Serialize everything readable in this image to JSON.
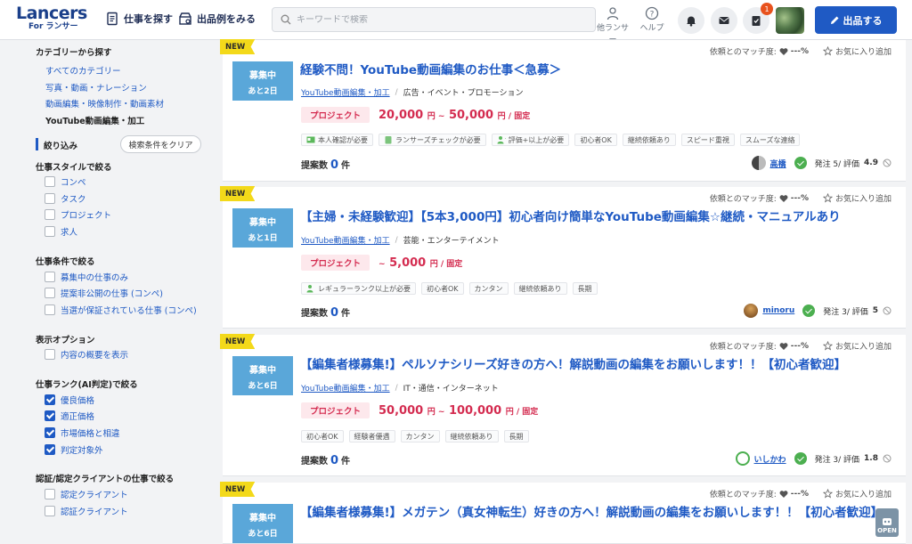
{
  "header": {
    "logo_main": "Lancers",
    "logo_sub": "For ランサー",
    "nav_find_jobs": "仕事を探す",
    "nav_examples": "出品例をみる",
    "search_placeholder": "キーワードで検索",
    "other_lancers": "他ランサー",
    "help": "ヘルプ",
    "notification_count": "1",
    "post_button": "出品する"
  },
  "sidebar": {
    "category_heading": "カテゴリーから探す",
    "categories": [
      "すべてのカテゴリー",
      "写真・動画・ナレーション",
      "動画編集・映像制作・動画素材"
    ],
    "current_category": "YouTube動画編集・加工",
    "filter_heading": "絞り込み",
    "clear_button": "検索条件をクリア",
    "groups": [
      {
        "title": "仕事スタイルで絞る",
        "items": [
          {
            "label": "コンペ",
            "checked": false
          },
          {
            "label": "タスク",
            "checked": false
          },
          {
            "label": "プロジェクト",
            "checked": false
          },
          {
            "label": "求人",
            "checked": false
          }
        ]
      },
      {
        "title": "仕事条件で絞る",
        "items": [
          {
            "label": "募集中の仕事のみ",
            "checked": false
          },
          {
            "label": "提案非公開の仕事 (コンペ)",
            "checked": false
          },
          {
            "label": "当選が保証されている仕事 (コンペ)",
            "checked": false
          }
        ]
      },
      {
        "title": "表示オプション",
        "items": [
          {
            "label": "内容の概要を表示",
            "checked": false
          }
        ]
      },
      {
        "title": "仕事ランク(AI判定)で絞る",
        "items": [
          {
            "label": "優良価格",
            "checked": true
          },
          {
            "label": "適正価格",
            "checked": true
          },
          {
            "label": "市場価格と相違",
            "checked": true
          },
          {
            "label": "判定対象外",
            "checked": true
          }
        ]
      },
      {
        "title": "認証/認定クライアントの仕事で絞る",
        "items": [
          {
            "label": "認定クライアント",
            "checked": false
          },
          {
            "label": "認証クライアント",
            "checked": false
          }
        ]
      }
    ]
  },
  "common": {
    "new_label": "NEW",
    "match_label": "依頼とのマッチ度:",
    "match_value": "---%",
    "fav_label": "お気に入り追加",
    "project_label": "プロジェクト",
    "proposals_label": "提案数",
    "proposals_unit": "件",
    "open_label": "OPEN"
  },
  "jobs": [
    {
      "status": "募集中",
      "remaining": "あと2日",
      "title": "経験不問！YouTube動画編集のお仕事＜急募＞",
      "category": "YouTube動画編集・加工",
      "industry": "広告・イベント・プロモーション",
      "price_min": "20,000",
      "price_max": "50,000",
      "price_sep": "円 ~",
      "price_unit": "円 / 固定",
      "tags": [
        "本人確認が必要",
        "ランサーズチェックが必要",
        "評価+以上が必要",
        "初心者OK",
        "継続依頼あり",
        "スピード重視",
        "スムーズな連絡"
      ],
      "proposals": "0",
      "client_name": "高橋",
      "client_stats": "発注 5/ 評価",
      "client_rating": "4.9"
    },
    {
      "status": "募集中",
      "remaining": "あと1日",
      "title": "【主婦・未経験歓迎】【5本3,000円】初心者向け簡単なYouTube動画編集☆継続・マニュアルあり",
      "category": "YouTube動画編集・加工",
      "industry": "芸能・エンターテイメント",
      "price_min": "",
      "price_max": "5,000",
      "price_sep": "~",
      "price_unit": "円 / 固定",
      "tags": [
        "レギュラーランク以上が必要",
        "初心者OK",
        "カンタン",
        "継続依頼あり",
        "長期"
      ],
      "proposals": "0",
      "client_name": "minoru",
      "client_stats": "発注 3/ 評価",
      "client_rating": "5"
    },
    {
      "status": "募集中",
      "remaining": "あと6日",
      "title": "【編集者様募集!】ペルソナシリーズ好きの方へ！解説動画の編集をお願いします！！【初心者歓迎】",
      "category": "YouTube動画編集・加工",
      "industry": "IT・通信・インターネット",
      "price_min": "50,000",
      "price_max": "100,000",
      "price_sep": "円 ~",
      "price_unit": "円 / 固定",
      "tags": [
        "初心者OK",
        "経験者優遇",
        "カンタン",
        "継続依頼あり",
        "長期"
      ],
      "proposals": "0",
      "client_name": "いしかわ",
      "client_stats": "発注 3/ 評価",
      "client_rating": "1.8"
    },
    {
      "status": "募集中",
      "remaining": "あと6日",
      "title": "【編集者様募集!】メガテン（真女神転生）好きの方へ！解説動画の編集をお願いします！！【初心者歓迎】"
    }
  ],
  "colors": {
    "brand": "#1f5ac4",
    "price": "#d42c50",
    "status": "#5aa7d9",
    "new": "#f3d91a"
  }
}
